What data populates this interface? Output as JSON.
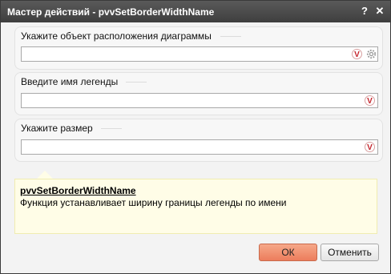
{
  "window": {
    "title": "Мастер действий - pvvSetBorderWidthName",
    "help_label": "?",
    "close_label": "✕"
  },
  "fields": [
    {
      "label": "Укажите объект расположения диаграммы",
      "value": "",
      "has_gear": true
    },
    {
      "label": "Введите имя легенды",
      "value": "",
      "has_gear": false
    },
    {
      "label": "Укажите размер",
      "value": "",
      "has_gear": false
    }
  ],
  "validate_icon": "V",
  "info": {
    "function_name": "pvvSetBorderWidthName",
    "description": "Функция устанавливает ширину границы легенды по имени"
  },
  "buttons": {
    "ok": "ОК",
    "cancel": "Отменить"
  },
  "colors": {
    "titlebar": "#4a4a4a",
    "ok_button": "#ef8b6a",
    "info_background": "#fffde7",
    "validate_icon": "#c4232b"
  }
}
